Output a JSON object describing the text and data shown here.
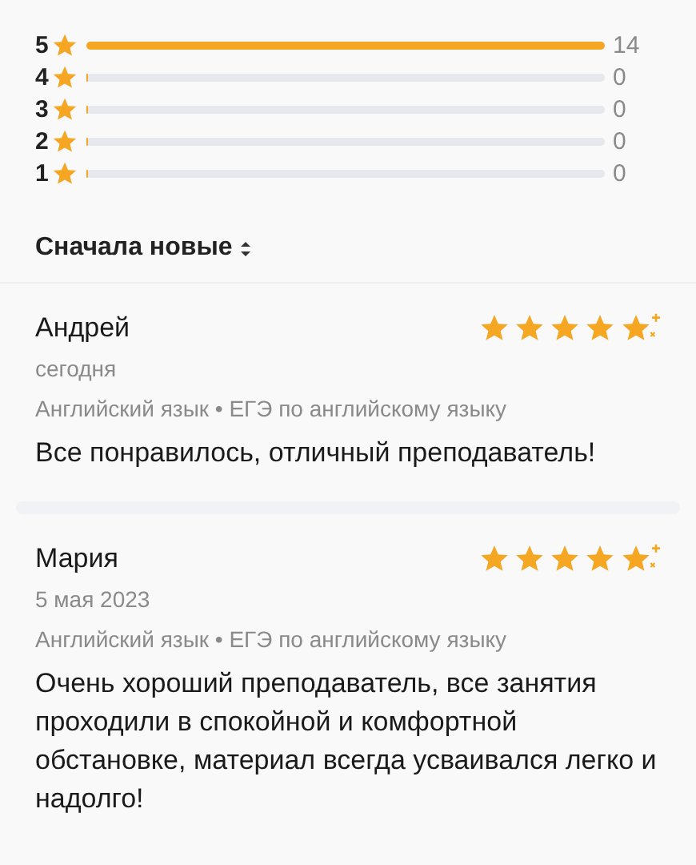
{
  "histogram": [
    {
      "label": "5",
      "level": 1,
      "count": "14"
    },
    {
      "label": "4",
      "level": 0,
      "count": "0"
    },
    {
      "label": "3",
      "level": 0,
      "count": "0"
    },
    {
      "label": "2",
      "level": 0,
      "count": "0"
    },
    {
      "label": "1",
      "level": 0,
      "count": "0"
    }
  ],
  "sort": {
    "label": "Сначала новые"
  },
  "reviews": [
    {
      "author": "Андрей",
      "stars": 5,
      "date": "сегодня",
      "subject": "Английский язык • ЕГЭ по английскому языку",
      "text": "Все понравилось, отличный преподаватель!"
    },
    {
      "author": "Мария",
      "stars": 5,
      "date": "5 мая 2023",
      "subject": "Английский язык • ЕГЭ по английскому языку",
      "text": "Очень хороший преподаватель, все занятия проходили в спокойной и комфортной обстановке, материал всегда усваивался легко и надолго!"
    }
  ]
}
